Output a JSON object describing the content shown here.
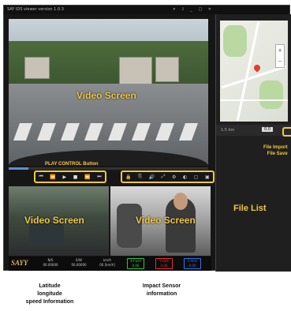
{
  "titlebar": {
    "title": "SAY IDS viewer    version 1.0.3",
    "controls": "▾ ⇩ _ □ ✕"
  },
  "main_video": {
    "label": "Video Screen"
  },
  "sub_video_left": {
    "label": "Video Screen"
  },
  "sub_video_right": {
    "label": "Video Screen"
  },
  "playback": {
    "label": "PLAY CONTROL Button",
    "buttons": [
      "⏮",
      "⏪",
      "▶",
      "■",
      "⏩",
      "⏭"
    ],
    "progress": 0.1
  },
  "tools": {
    "icons": [
      "🔒",
      "⎘",
      "🔊",
      "⤢",
      "⚙",
      "◐",
      "▢",
      "▣"
    ]
  },
  "status_bar": {
    "logo": "SAYY",
    "latitude": {
      "label": "N/S",
      "value": "00.00000"
    },
    "longitude": {
      "label": "E/W",
      "value": "00.00000"
    },
    "speed": {
      "label": "km/h",
      "value": "00 [km/h]"
    },
    "impact": [
      {
        "axis": "X-Fwrd",
        "value": "0.00",
        "color": "#39c23b"
      },
      {
        "axis": "Y-Side",
        "value": "0.00",
        "color": "#e03131"
      },
      {
        "axis": "Z-Vert",
        "value": "0.00",
        "color": "#3b6ee8"
      }
    ]
  },
  "map": {
    "tool_a": "1:5 km",
    "tool_b": "0.0"
  },
  "file_panel": {
    "import_save_label_1": "File Import",
    "import_save_label_2": "File Save",
    "list_label": "File List"
  },
  "captions": {
    "gps_1": "Latitude",
    "gps_2": "longitude",
    "gps_3": "speed Information",
    "impact_1": "Impact Sensor",
    "impact_2": "information"
  }
}
